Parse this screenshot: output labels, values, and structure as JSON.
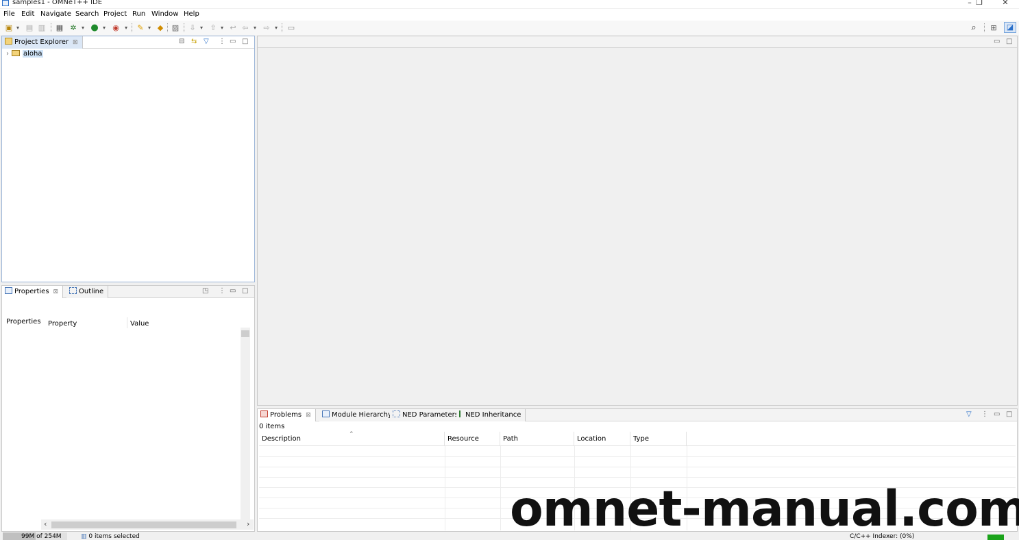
{
  "window": {
    "title": "samples1 - OMNeT++ IDE",
    "controls": [
      "–",
      "❐",
      "✕"
    ]
  },
  "menu": [
    "File",
    "Edit",
    "Navigate",
    "Search",
    "Project",
    "Run",
    "Window",
    "Help"
  ],
  "project_explorer": {
    "tab_label": "Project Explorer",
    "tree": [
      {
        "label": "aloha",
        "expanded": false
      }
    ]
  },
  "properties_panel": {
    "tabs": [
      "Properties",
      "Outline"
    ],
    "headers": {
      "left": "Properties",
      "property": "Property",
      "value": "Value"
    }
  },
  "problems_panel": {
    "tabs": [
      "Problems",
      "Module Hierarchy",
      "NED Parameters",
      "NED Inheritance"
    ],
    "item_count": "0 items",
    "columns": [
      "Description",
      "Resource",
      "Path",
      "Location",
      "Type"
    ]
  },
  "status_bar": {
    "memory": "99M of 254M",
    "selection": "0 items selected",
    "indexer": "C/C++ Indexer: (0%)"
  },
  "watermark": "omnet-manual.com",
  "colors": {
    "accent": "#2a6fc9",
    "progress": "#1aa31a",
    "selected_tab": "#dbe7f6"
  }
}
